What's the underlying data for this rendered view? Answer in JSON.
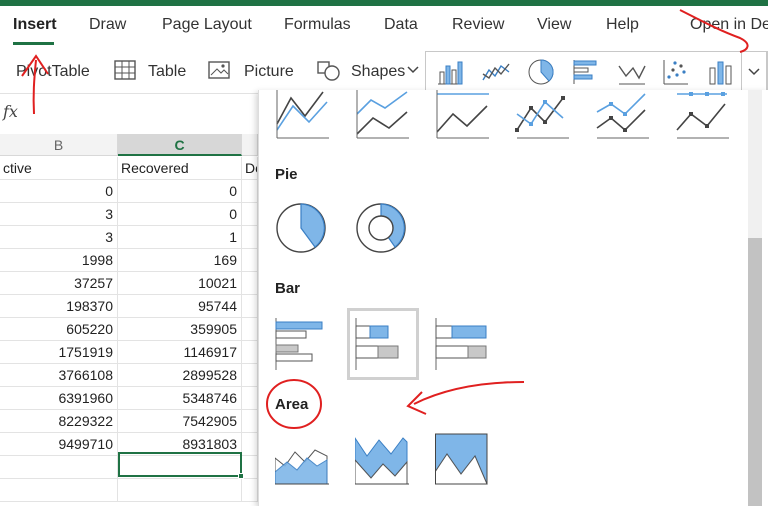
{
  "tabs": {
    "insert": "Insert",
    "draw": "Draw",
    "page_layout": "Page Layout",
    "formulas": "Formulas",
    "data": "Data",
    "review": "Review",
    "view": "View",
    "help": "Help",
    "open_desktop": "Open in De"
  },
  "ribbon": {
    "pivottable": "PivotTable",
    "table": "Table",
    "picture": "Picture",
    "shapes": "Shapes"
  },
  "formula_bar": {
    "fx": "fx"
  },
  "grid": {
    "col_b": "B",
    "col_c": "C",
    "header": {
      "b": "ctive",
      "c": "Recovered",
      "d": "De"
    },
    "rows": [
      {
        "b": "0",
        "c": "0"
      },
      {
        "b": "3",
        "c": "0"
      },
      {
        "b": "3",
        "c": "1"
      },
      {
        "b": "1998",
        "c": "169"
      },
      {
        "b": "37257",
        "c": "10021"
      },
      {
        "b": "198370",
        "c": "95744"
      },
      {
        "b": "605220",
        "c": "359905"
      },
      {
        "b": "1751919",
        "c": "1146917"
      },
      {
        "b": "3766108",
        "c": "2899528"
      },
      {
        "b": "6391960",
        "c": "5348746"
      },
      {
        "b": "8229322",
        "c": "7542905"
      },
      {
        "b": "9499710",
        "c": "8931803"
      },
      {
        "b": "",
        "c": ""
      },
      {
        "b": "",
        "c": ""
      }
    ]
  },
  "chart_panel": {
    "pie_title": "Pie",
    "bar_title": "Bar",
    "area_title": "Area"
  },
  "colors": {
    "accent": "#1f7244",
    "chart_blue": "#7fb6e8",
    "annotation_red": "#e02020"
  }
}
